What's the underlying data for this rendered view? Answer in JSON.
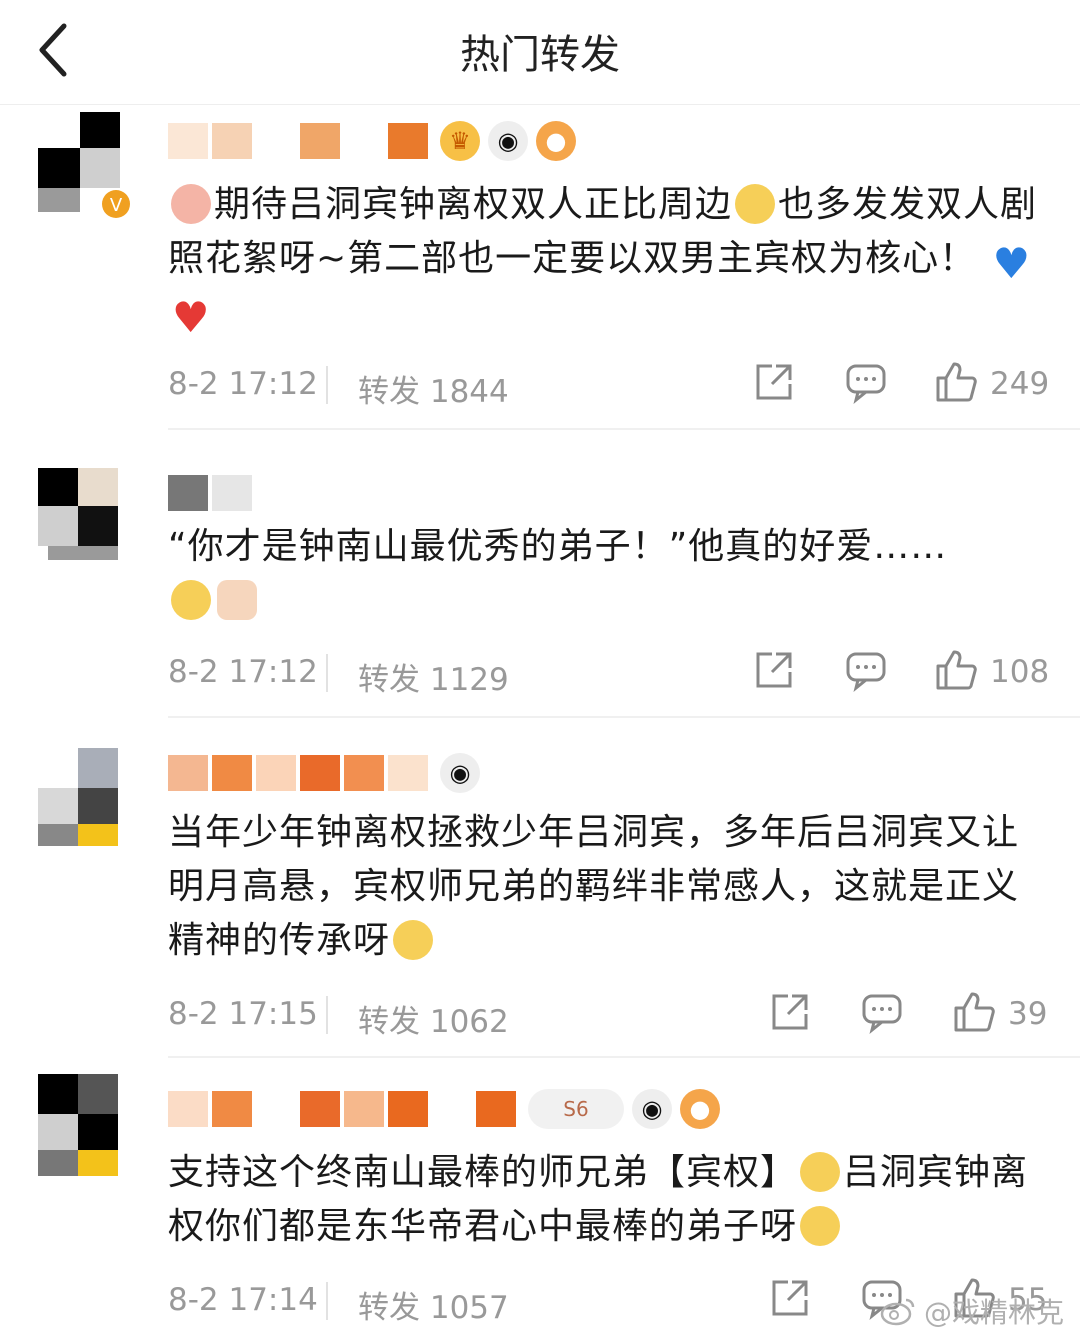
{
  "header": {
    "title": "热门转发"
  },
  "posts": [
    {
      "text_parts": [
        "期待吕洞宾钟离权双人正比周边",
        "也多发发双人剧照花絮呀~第二部也一定要以双男主宾权为核心！"
      ],
      "time": "8-2 17:12",
      "forwards": "转发 1844",
      "likes": "249"
    },
    {
      "text": "“你才是钟南山最优秀的弟子！”他真的好爱……",
      "time": "8-2 17:12",
      "forwards": "转发 1129",
      "likes": "108"
    },
    {
      "text": "当年少年钟离权拯救少年吕洞宾，多年后吕洞宾又让明月高悬，宾权师兄弟的羁绊非常感人，这就是正义精神的传承呀",
      "time": "8-2 17:15",
      "forwards": "转发 1062",
      "likes": "39"
    },
    {
      "text_parts": [
        "支持这个终南山最棒的师兄弟【宾权】",
        "吕洞宾钟离权你们都是东华帝君心中最棒的弟子呀"
      ],
      "badge_text": "S6",
      "time": "8-2 17:14",
      "forwards": "转发 1057",
      "likes": "55"
    }
  ],
  "watermark": "@戏精林克",
  "colors": {
    "text": "#1a1a1a",
    "meta": "#999999",
    "accent": "#f07a1a",
    "heart_blue": "#2a7fe0",
    "heart_red": "#e53935"
  }
}
